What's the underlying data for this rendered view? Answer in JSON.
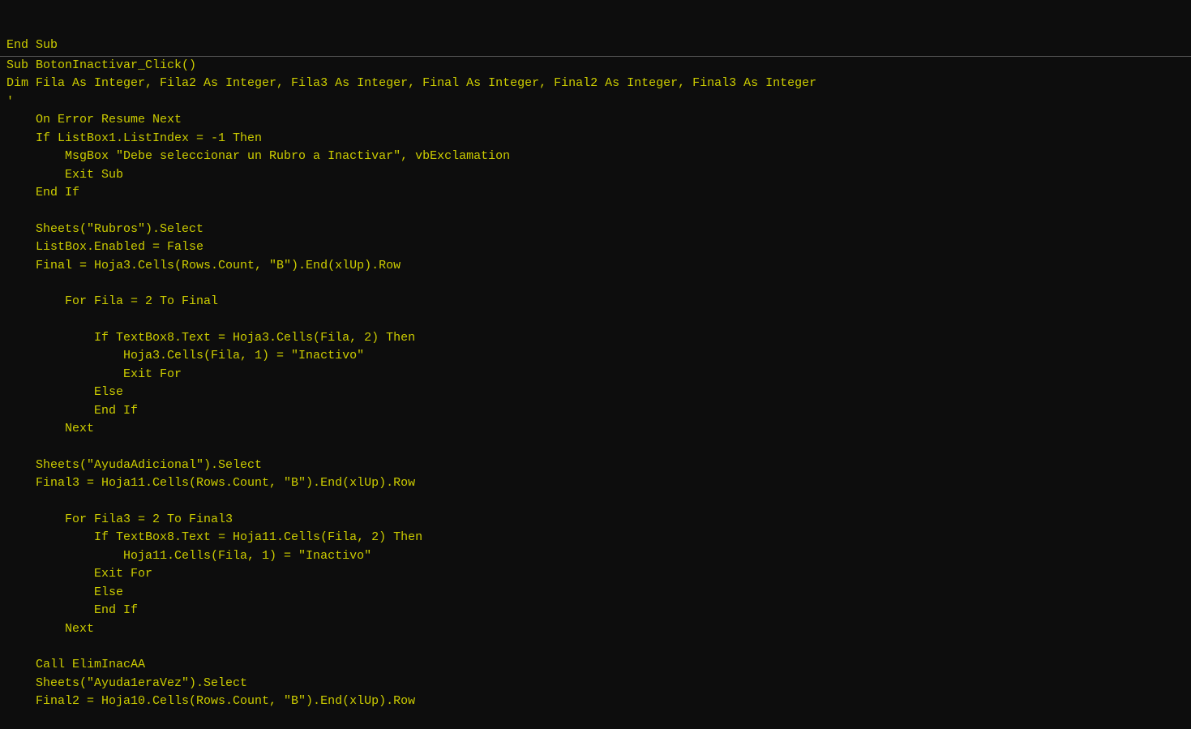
{
  "code": {
    "lines": [
      "End Sub",
      "Sub BotonInactivar_Click()",
      "Dim Fila As Integer, Fila2 As Integer, Fila3 As Integer, Final As Integer, Final2 As Integer, Final3 As Integer",
      "'",
      "    On Error Resume Next",
      "    If ListBox1.ListIndex = -1 Then",
      "        MsgBox \"Debe seleccionar un Rubro a Inactivar\", vbExclamation",
      "        Exit Sub",
      "    End If",
      "",
      "    Sheets(\"Rubros\").Select",
      "    ListBox.Enabled = False",
      "    Final = Hoja3.Cells(Rows.Count, \"B\").End(xlUp).Row",
      "",
      "        For Fila = 2 To Final",
      "",
      "            If TextBox8.Text = Hoja3.Cells(Fila, 2) Then",
      "                Hoja3.Cells(Fila, 1) = \"Inactivo\"",
      "                Exit For",
      "            Else",
      "            End If",
      "        Next",
      "",
      "    Sheets(\"AyudaAdicional\").Select",
      "    Final3 = Hoja11.Cells(Rows.Count, \"B\").End(xlUp).Row",
      "",
      "        For Fila3 = 2 To Final3",
      "            If TextBox8.Text = Hoja11.Cells(Fila, 2) Then",
      "                Hoja11.Cells(Fila, 1) = \"Inactivo\"",
      "            Exit For",
      "            Else",
      "            End If",
      "        Next",
      "",
      "    Call ElimInacAA",
      "    Sheets(\"Ayuda1eraVez\").Select",
      "    Final2 = Hoja10.Cells(Rows.Count, \"B\").End(xlUp).Row"
    ]
  }
}
